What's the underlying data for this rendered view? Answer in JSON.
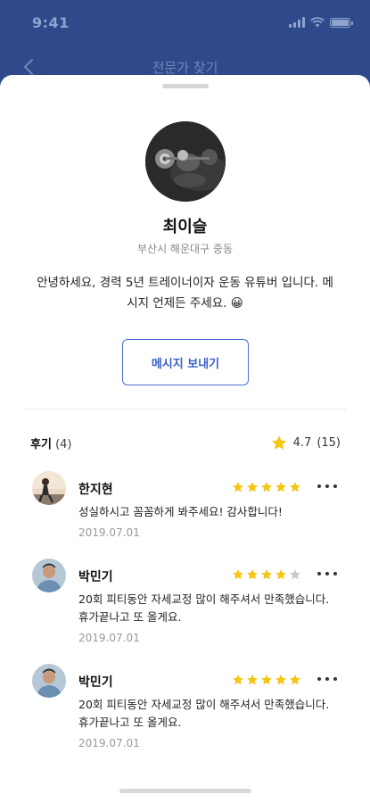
{
  "status_bar": {
    "time": "9:41"
  },
  "nav": {
    "title": "전문가 찾기"
  },
  "profile": {
    "name": "최이슬",
    "location": "부산시 해운대구 중동",
    "bio": "안녕하세요, 경력 5년 트레이너이자 운동 유튜버 입니다. 메시지 언제든 주세요. 😀",
    "message_button": "메시지 보내기"
  },
  "reviews_header": {
    "label": "후기",
    "count": "(4)",
    "rating": "4.7",
    "rating_count": "(15)"
  },
  "reviews": [
    {
      "name": "한지현",
      "text": "성실하시고 꼼꼼하게 봐주세요! 감사합니다!",
      "date": "2019.07.01",
      "stars": 5
    },
    {
      "name": "박민기",
      "text": "20회 피티동안 자세교정 많이 해주셔서 만족했습니다. 휴가끝나고 또 올게요.",
      "date": "2019.07.01",
      "stars": 4
    },
    {
      "name": "박민기",
      "text": "20회 피티동안 자세교정 많이 해주셔서 만족했습니다. 휴가끝나고 또 올게요.",
      "date": "2019.07.01",
      "stars": 5
    }
  ],
  "colors": {
    "header": "#2e4a8b",
    "accent": "#3a5fc7",
    "star_filled": "#f5c518",
    "star_empty": "#c9c9c9"
  }
}
